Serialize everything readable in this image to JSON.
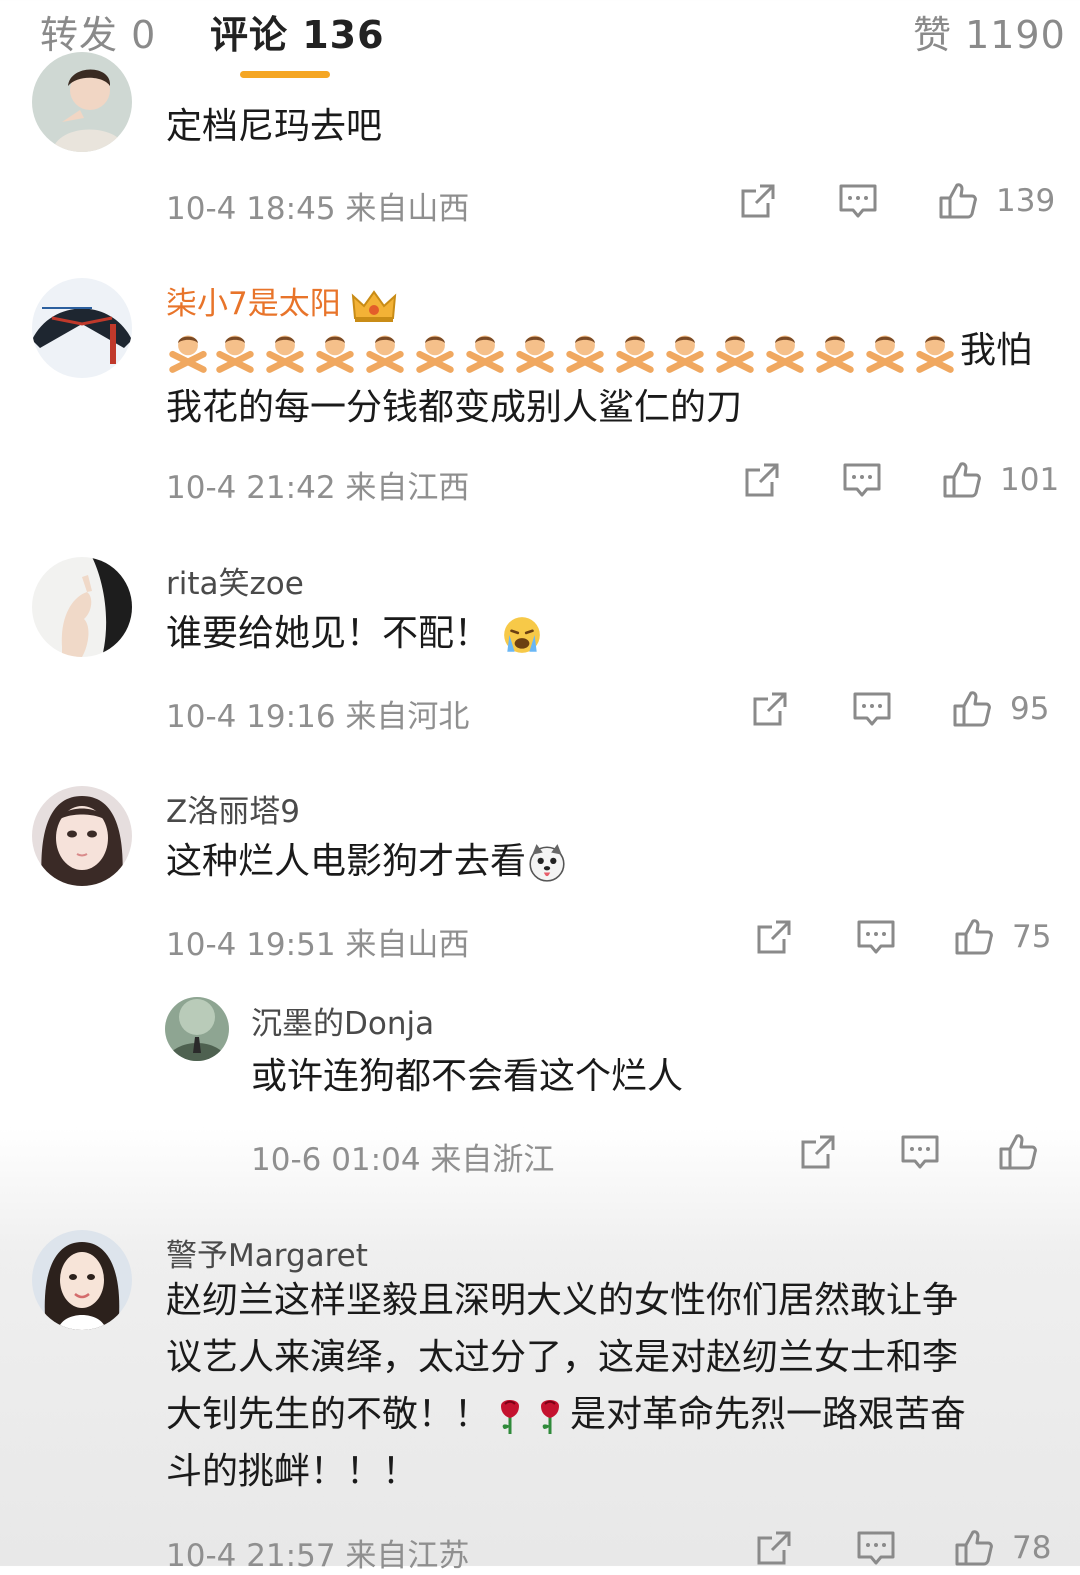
{
  "tabs": [
    {
      "label": "转发 0",
      "active": false
    },
    {
      "label": "评论 136",
      "active": true
    },
    {
      "label": "赞 1190",
      "active": false
    }
  ],
  "comments": [
    {
      "username": "",
      "text": "定档尼玛去吧",
      "time": "10-4 18:45",
      "location": "来自山西",
      "likes": "139"
    },
    {
      "username": "柒小7是太阳",
      "text_tail": "我怕",
      "text_line2": "我花的每一分钱都变成别人鲨仁的刀",
      "time": "10-4 21:42",
      "location": "来自江西",
      "likes": "101"
    },
    {
      "username": "rita笑zoe",
      "text": "谁要给她见！不配！",
      "time": "10-4 19:16",
      "location": "来自河北",
      "likes": "95"
    },
    {
      "username": "Z洛丽塔9",
      "text": "这种烂人电影狗才去看",
      "time": "10-4 19:51",
      "location": "来自山西",
      "likes": "75"
    },
    {
      "username": "沉墨的Donja",
      "text": "或许连狗都不会看这个烂人",
      "time": "10-6 01:04",
      "location": "来自浙江",
      "likes": ""
    },
    {
      "username": "警予Margaret",
      "line1": "赵纫兰这样坚毅且深明大义的女性你们居然敢让争",
      "line2": "议艺人来演绎，太过分了，这是对赵纫兰女士和李",
      "line3a": "大钊先生的不敬！！",
      "line3b": "是对革命先烈一路艰苦奋",
      "line4": "斗的挑衅！！！",
      "time": "10-4 21:57",
      "location": "来自江苏",
      "likes": "78"
    }
  ],
  "icons": {
    "share": "share-icon",
    "reply": "comment-icon",
    "like": "thumbs-up-icon",
    "vip": "crown-icon",
    "gesture": "no-gesture-emoji",
    "rose": "rose-emoji"
  },
  "colors": {
    "accent": "#f5a623",
    "vip_name": "#e8742a",
    "meta": "#8f8f8f"
  }
}
